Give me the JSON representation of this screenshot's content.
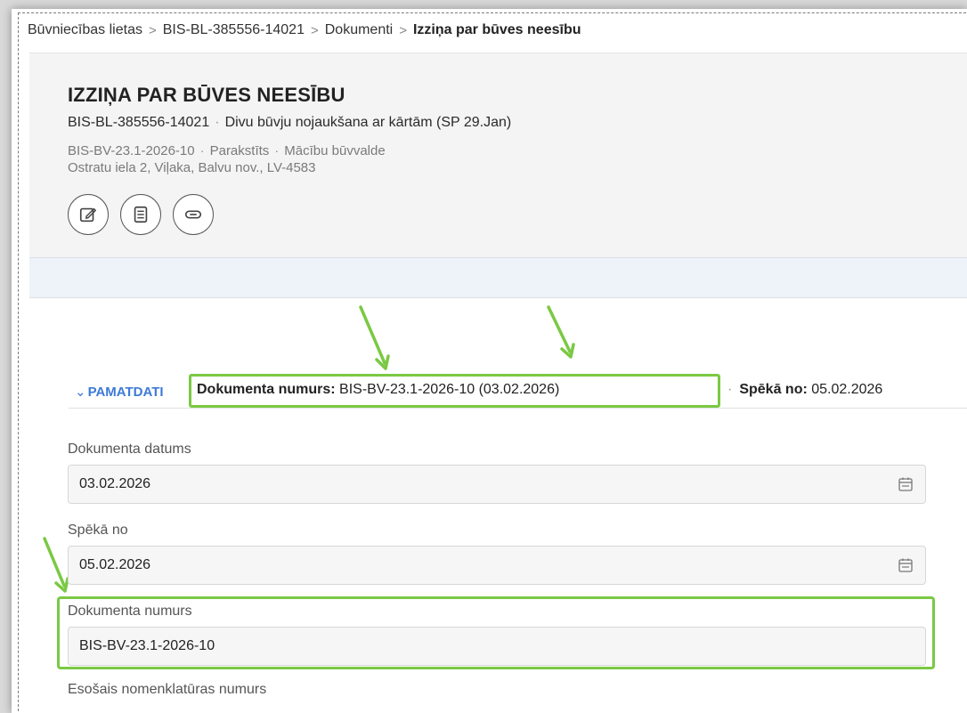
{
  "breadcrumb": {
    "items": [
      "Būvniecības lietas",
      "BIS-BL-385556-14021",
      "Dokumenti"
    ],
    "current": "Izziņa par būves neesību",
    "separator": ">"
  },
  "header": {
    "title": "IZZIŅA PAR BŪVES NEESĪBU",
    "case_id": "BIS-BL-385556-14021",
    "case_name": "Divu būvju nojaukšana ar kārtām (SP 29.Jan)",
    "doc_id": "BIS-BV-23.1-2026-10",
    "status": "Parakstīts",
    "authority": "Mācību būvvalde",
    "address": "Ostratu iela 2, Viļaka, Balvu nov., LV-4583",
    "separator_dot": "·"
  },
  "actions": {
    "icons": [
      "edit-icon",
      "document-icon",
      "link-icon"
    ]
  },
  "section": {
    "chevron": "⌄",
    "label": "PAMATDATI",
    "summary_label": "Dokumenta numurs:",
    "summary_value": "BIS-BV-23.1-2026-10 (03.02.2026)",
    "effective_label": "Spēkā no:",
    "effective_value": "05.02.2026"
  },
  "fields": {
    "document_date": {
      "label": "Dokumenta datums",
      "value": "03.02.2026"
    },
    "effective_from": {
      "label": "Spēkā no",
      "value": "05.02.2026"
    },
    "document_number": {
      "label": "Dokumenta numurs",
      "value": "BIS-BV-23.1-2026-10"
    },
    "nomenclature_number": {
      "label": "Esošais nomenklatūras numurs"
    }
  },
  "colors": {
    "highlight": "#7ac943",
    "link_blue": "#3c7ad6",
    "header_bg": "#f4f4f5",
    "band_bg": "#eef2f9"
  }
}
